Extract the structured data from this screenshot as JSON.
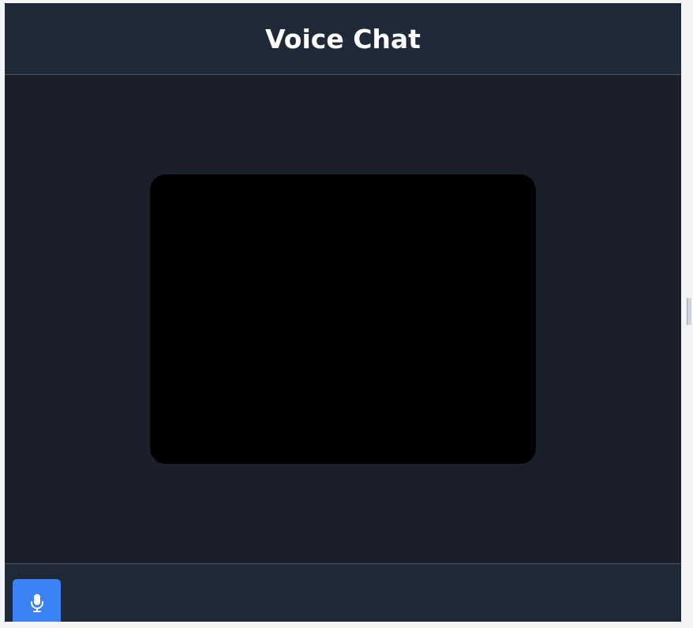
{
  "header": {
    "title": "Voice Chat"
  },
  "controls": {
    "mic_icon": "microphone-icon",
    "mic_color": "#3b82f6"
  },
  "colors": {
    "header_bg": "#1f2937",
    "stage_bg": "#1a1f2b",
    "video_bg": "#000000",
    "accent": "#3b82f6"
  }
}
